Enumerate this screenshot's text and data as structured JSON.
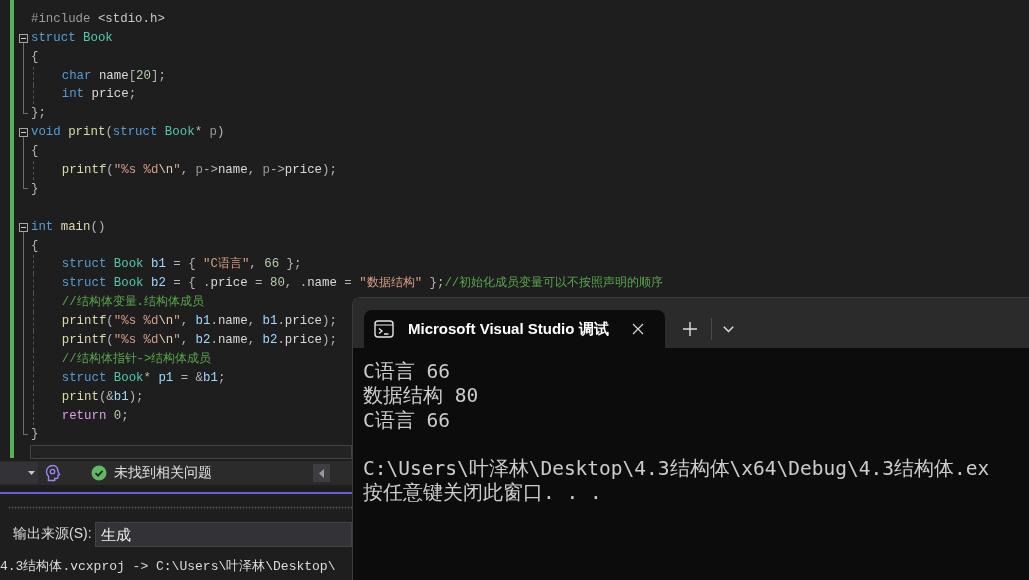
{
  "code_lines": [
    {
      "kind": "code",
      "tokens": [
        {
          "text": "#include",
          "kind": "preprocessor"
        },
        {
          "text": " <stdio.h>",
          "kind": "plain"
        }
      ]
    },
    {
      "kind": "header",
      "expanded": true,
      "tokens": [
        {
          "text": "struct",
          "kind": "keyword"
        },
        {
          "text": " Book",
          "kind": "type"
        }
      ],
      "children": [
        {
          "kind": "code",
          "tokens": [
            {
              "text": "{",
              "kind": "punct"
            }
          ],
          "children": [
            {
              "kind": "code",
              "tokens": [
                {
                  "text": "char",
                  "kind": "keyword"
                },
                {
                  "text": " name",
                  "kind": "field"
                },
                {
                  "text": "[",
                  "kind": "punct"
                },
                {
                  "text": "20",
                  "kind": "number"
                },
                {
                  "text": "];",
                  "kind": "punct"
                }
              ]
            },
            {
              "kind": "code",
              "tokens": [
                {
                  "text": "int",
                  "kind": "keyword"
                },
                {
                  "text": " price",
                  "kind": "field"
                },
                {
                  "text": ";",
                  "kind": "punct"
                }
              ]
            }
          ]
        },
        {
          "kind": "code",
          "tokens": [
            {
              "text": "};",
              "kind": "punct"
            }
          ]
        }
      ]
    },
    {
      "kind": "header",
      "expanded": true,
      "tokens": [
        {
          "text": "void",
          "kind": "keyword"
        },
        {
          "text": " print",
          "kind": "function"
        },
        {
          "text": "(",
          "kind": "punct"
        },
        {
          "text": "struct",
          "kind": "keyword"
        },
        {
          "text": " Book",
          "kind": "type"
        },
        {
          "text": "*",
          "kind": "punct"
        },
        {
          "text": " p",
          "kind": "param"
        },
        {
          "text": ")",
          "kind": "punct"
        }
      ],
      "children": [
        {
          "kind": "code",
          "tokens": [
            {
              "text": "{",
              "kind": "punct"
            }
          ],
          "children": [
            {
              "kind": "code",
              "tokens": [
                {
                  "text": "printf",
                  "kind": "function"
                },
                {
                  "text": "(",
                  "kind": "punct"
                },
                {
                  "text": "\"%s %d",
                  "kind": "string"
                },
                {
                  "text": "\\n",
                  "kind": "escape"
                },
                {
                  "text": "\"",
                  "kind": "string"
                },
                {
                  "text": ", ",
                  "kind": "punct"
                },
                {
                  "text": "p",
                  "kind": "param"
                },
                {
                  "text": "->",
                  "kind": "punct"
                },
                {
                  "text": "name",
                  "kind": "field"
                },
                {
                  "text": ", ",
                  "kind": "punct"
                },
                {
                  "text": "p",
                  "kind": "param"
                },
                {
                  "text": "->",
                  "kind": "punct"
                },
                {
                  "text": "price",
                  "kind": "field"
                },
                {
                  "text": ");",
                  "kind": "punct"
                }
              ]
            }
          ]
        },
        {
          "kind": "code",
          "tokens": [
            {
              "text": "}",
              "kind": "punct"
            }
          ]
        }
      ]
    },
    {
      "kind": "blank"
    },
    {
      "kind": "header",
      "expanded": true,
      "tokens": [
        {
          "text": "int",
          "kind": "keyword"
        },
        {
          "text": " main",
          "kind": "function"
        },
        {
          "text": "()",
          "kind": "punct"
        }
      ],
      "children": [
        {
          "kind": "code",
          "tokens": [
            {
              "text": "{",
              "kind": "punct"
            }
          ],
          "children": [
            {
              "kind": "code",
              "tokens": [
                {
                  "text": "struct",
                  "kind": "keyword"
                },
                {
                  "text": " Book",
                  "kind": "type"
                },
                {
                  "text": " b1",
                  "kind": "local"
                },
                {
                  "text": " = { ",
                  "kind": "punct"
                },
                {
                  "text": "\"C语言\"",
                  "kind": "string"
                },
                {
                  "text": ", ",
                  "kind": "punct"
                },
                {
                  "text": "66",
                  "kind": "number"
                },
                {
                  "text": " };",
                  "kind": "punct"
                }
              ]
            },
            {
              "kind": "code",
              "tokens": [
                {
                  "text": "struct",
                  "kind": "keyword"
                },
                {
                  "text": " Book",
                  "kind": "type"
                },
                {
                  "text": " b2",
                  "kind": "local"
                },
                {
                  "text": " = { .",
                  "kind": "punct"
                },
                {
                  "text": "price",
                  "kind": "field"
                },
                {
                  "text": " = ",
                  "kind": "punct"
                },
                {
                  "text": "80",
                  "kind": "number"
                },
                {
                  "text": ", .",
                  "kind": "punct"
                },
                {
                  "text": "name",
                  "kind": "field"
                },
                {
                  "text": " = ",
                  "kind": "punct"
                },
                {
                  "text": "\"数据结构\"",
                  "kind": "string"
                },
                {
                  "text": " };",
                  "kind": "punct"
                },
                {
                  "text": "//初始化成员变量可以不按照声明的顺序",
                  "kind": "comment"
                }
              ]
            },
            {
              "kind": "code",
              "tokens": [
                {
                  "text": "//结构体变量.结构体成员",
                  "kind": "comment"
                }
              ]
            },
            {
              "kind": "code",
              "tokens": [
                {
                  "text": "printf",
                  "kind": "function"
                },
                {
                  "text": "(",
                  "kind": "punct"
                },
                {
                  "text": "\"%s %d",
                  "kind": "string"
                },
                {
                  "text": "\\n",
                  "kind": "escape"
                },
                {
                  "text": "\"",
                  "kind": "string"
                },
                {
                  "text": ", ",
                  "kind": "punct"
                },
                {
                  "text": "b1",
                  "kind": "local"
                },
                {
                  "text": ".",
                  "kind": "punct"
                },
                {
                  "text": "name",
                  "kind": "field"
                },
                {
                  "text": ", ",
                  "kind": "punct"
                },
                {
                  "text": "b1",
                  "kind": "local"
                },
                {
                  "text": ".",
                  "kind": "punct"
                },
                {
                  "text": "price",
                  "kind": "field"
                },
                {
                  "text": ");",
                  "kind": "punct"
                }
              ]
            },
            {
              "kind": "code",
              "tokens": [
                {
                  "text": "printf",
                  "kind": "function"
                },
                {
                  "text": "(",
                  "kind": "punct"
                },
                {
                  "text": "\"%s %d",
                  "kind": "string"
                },
                {
                  "text": "\\n",
                  "kind": "escape"
                },
                {
                  "text": "\"",
                  "kind": "string"
                },
                {
                  "text": ", ",
                  "kind": "punct"
                },
                {
                  "text": "b2",
                  "kind": "local"
                },
                {
                  "text": ".",
                  "kind": "punct"
                },
                {
                  "text": "name",
                  "kind": "field"
                },
                {
                  "text": ", ",
                  "kind": "punct"
                },
                {
                  "text": "b2",
                  "kind": "local"
                },
                {
                  "text": ".",
                  "kind": "punct"
                },
                {
                  "text": "price",
                  "kind": "field"
                },
                {
                  "text": ");",
                  "kind": "punct"
                }
              ]
            },
            {
              "kind": "code",
              "tokens": [
                {
                  "text": "//结构体指针->结构体成员",
                  "kind": "comment"
                }
              ]
            },
            {
              "kind": "code",
              "tokens": [
                {
                  "text": "struct",
                  "kind": "keyword"
                },
                {
                  "text": " Book",
                  "kind": "type"
                },
                {
                  "text": "*",
                  "kind": "punct"
                },
                {
                  "text": " p1",
                  "kind": "local"
                },
                {
                  "text": " = &",
                  "kind": "punct"
                },
                {
                  "text": "b1",
                  "kind": "local"
                },
                {
                  "text": ";",
                  "kind": "punct"
                }
              ]
            },
            {
              "kind": "code",
              "tokens": [
                {
                  "text": "print",
                  "kind": "function"
                },
                {
                  "text": "(&",
                  "kind": "punct"
                },
                {
                  "text": "b1",
                  "kind": "local"
                },
                {
                  "text": ");",
                  "kind": "punct"
                }
              ]
            },
            {
              "kind": "code",
              "tokens": [
                {
                  "text": "return",
                  "kind": "control"
                },
                {
                  "text": " 0",
                  "kind": "number"
                },
                {
                  "text": ";",
                  "kind": "punct"
                }
              ]
            }
          ]
        },
        {
          "kind": "code",
          "tokens": [
            {
              "text": "}",
              "kind": "punct"
            }
          ]
        }
      ]
    }
  ],
  "error_list": {
    "status": "未找到相关问题"
  },
  "output_panel": {
    "source_label": "输出来源(S):",
    "source_value": "生成",
    "lines": [
      "4.3结构体.vcxproj -> C:\\Users\\叶泽林\\Desktop\\"
    ]
  },
  "terminal": {
    "tabs": [
      {
        "title": "Microsoft Visual Studio 调试",
        "selected": true
      }
    ],
    "program_output": [
      "C语言 66",
      "数据结构 80",
      "C语言 66"
    ],
    "exit_message": [
      "C:\\Users\\叶泽林\\Desktop\\4.3结构体\\x64\\Debug\\4.3结构体.ex",
      "按任意键关闭此窗口. . ."
    ]
  }
}
